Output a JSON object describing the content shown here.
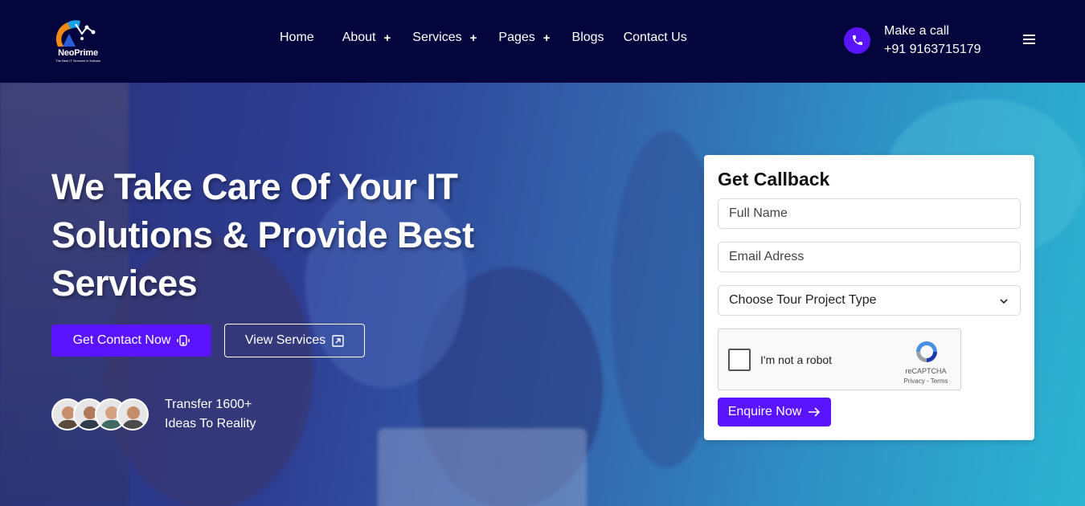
{
  "brand": {
    "name": "NeoPrime",
    "tagline": "The Best IT Services in Kolkata"
  },
  "nav": {
    "items": [
      {
        "label": "Home",
        "has_submenu": false
      },
      {
        "label": "About",
        "has_submenu": true
      },
      {
        "label": "Services",
        "has_submenu": true
      },
      {
        "label": "Pages",
        "has_submenu": true
      },
      {
        "label": "Blogs",
        "has_submenu": false
      },
      {
        "label": "Contact Us",
        "has_submenu": false
      }
    ],
    "submenu_symbol": "+"
  },
  "call": {
    "label": "Make a call",
    "phone": "+91 9163715179",
    "icon": "phone-icon"
  },
  "hero": {
    "title_line1": "We Take Care Of Your IT",
    "title_line2": "Solutions & Provide Best",
    "title_line3": "Services",
    "primary_button": "Get Contact Now",
    "secondary_button": "View Services",
    "stat_line1": "Transfer 1600+",
    "stat_line2": "Ideas To Reality"
  },
  "form": {
    "title": "Get Callback",
    "name_placeholder": "Full Name",
    "email_placeholder": "Email Adress",
    "project_type_selected": "Choose Tour Project Type",
    "captcha_label": "I'm not a robot",
    "captcha_brand": "reCAPTCHA",
    "captcha_links": "Privacy - Terms",
    "submit_button": "Enquire Now"
  },
  "colors": {
    "header_bg": "#05053e",
    "accent": "#5b14ff",
    "card_bg": "#ffffff"
  }
}
